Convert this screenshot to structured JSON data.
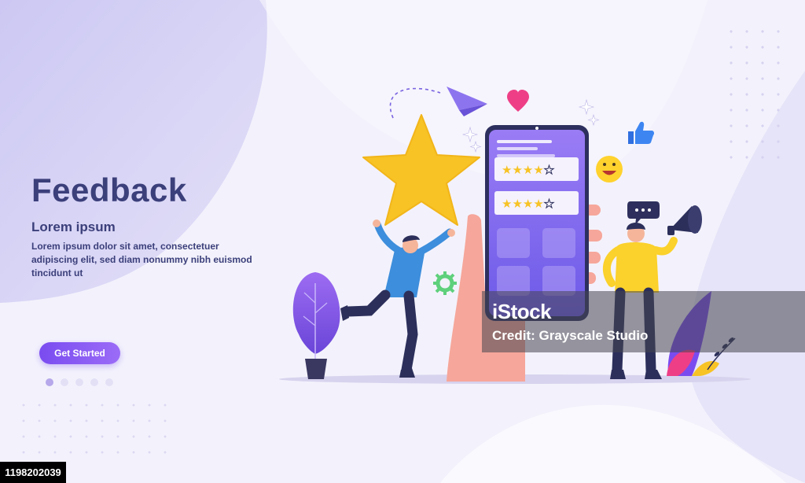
{
  "hero": {
    "title": "Feedback",
    "subtitle": "Lorem ipsum",
    "description": "Lorem ipsum dolor sit amet, consectetuer adipiscing elit, sed diam nonummy nibh euismod tincidunt ut",
    "cta_label": "Get Started"
  },
  "carousel": {
    "count": 5,
    "active_index": 0
  },
  "illustration": {
    "ratings": [
      {
        "stars": 4,
        "max": 5
      },
      {
        "stars": 4,
        "max": 5
      }
    ],
    "icons": [
      "paper-plane-icon",
      "heart-icon",
      "thumbs-up-icon",
      "smiley-icon",
      "speech-bubble-icon",
      "megaphone-icon",
      "gear-icon",
      "sparkle-icon"
    ]
  },
  "watermark": {
    "logo": "iStock",
    "credit": "Credit: Grayscale Studio"
  },
  "footer": {
    "image_id": "1198202039"
  },
  "colors": {
    "accent": "#7a4cf0",
    "title": "#3b3f7a",
    "star": "#f7c325",
    "phone": "#8a6df2"
  }
}
